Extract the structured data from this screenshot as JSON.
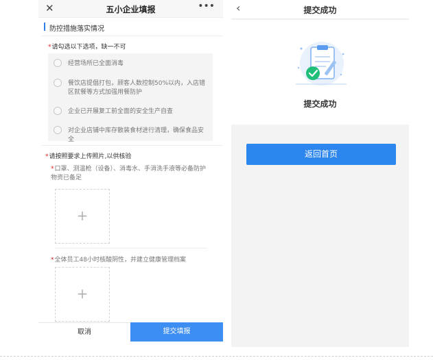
{
  "left": {
    "header": {
      "close_icon": "close-icon",
      "title": "五小企业填报",
      "more_icon": "more-icon"
    },
    "section_title": "防控措施落实情况",
    "q1": {
      "required_mark": "*",
      "label": "请勾选以下选项，缺一不可",
      "options": [
        "经营场所已全面消毒",
        "餐饮店提倡打包，顾客人数控制50%以内，入店错区就餐等方式加强用餐防护",
        "企业已开展复工前全面的安全生产自查",
        "对企业店铺中库存散装食材进行清理，确保食品安全"
      ]
    },
    "q2": {
      "required_mark": "*",
      "label": "请按照要求上传照片,以供核验"
    },
    "q3": {
      "required_mark": "*",
      "label": "口罩、测温枪（设备）、消毒水、手消洗手液等必备防护物资已备足",
      "upload_symbol": "+"
    },
    "q4": {
      "required_mark": "*",
      "label": "全体员工48小时核酸阴性，并建立健康管理档案",
      "upload_symbol": "+"
    },
    "buttons": {
      "cancel": "取消",
      "submit": "提交填报"
    }
  },
  "right": {
    "header": {
      "back_icon": "back-icon",
      "title": "提交成功"
    },
    "status_text": "提交成功",
    "illustration": "clipboard-success-icon",
    "home_button": "返回首页"
  },
  "colors": {
    "accent": "#3d8ef3",
    "primary_button": "#2d86ee",
    "success": "#1fbf7a",
    "required": "#e02020"
  }
}
